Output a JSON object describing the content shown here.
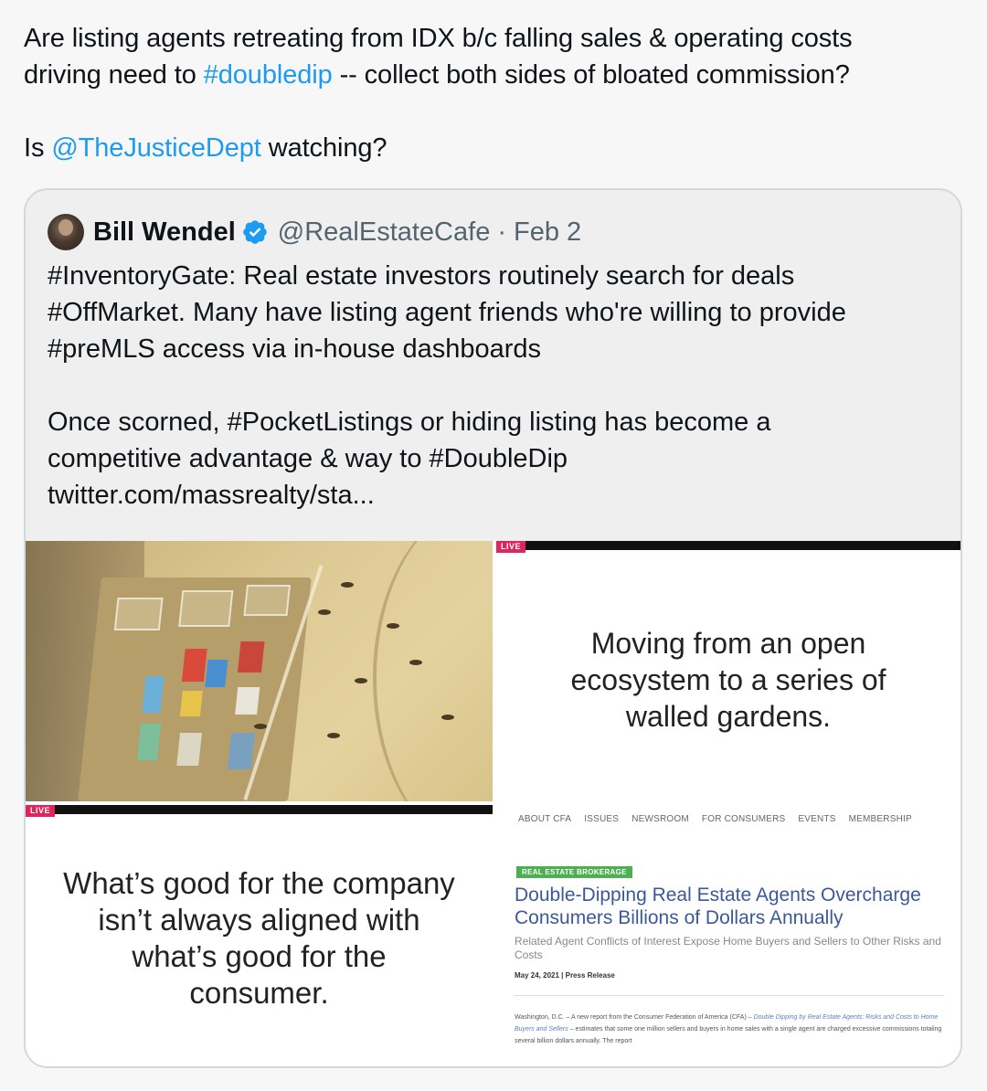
{
  "tweet": {
    "line1_a": "Are listing agents retreating from IDX b/c falling sales & operating costs",
    "line2_a": "driving need to ",
    "line2_link": "#doubledip",
    "line2_b": " -- collect both sides of bloated commission?",
    "line3_a": "Is ",
    "line3_link": "@TheJusticeDept",
    "line3_b": " watching?"
  },
  "quote": {
    "display_name": "Bill Wendel",
    "handle": "@RealEstateCafe",
    "separator": "·",
    "date": "Feb 2",
    "verified_icon": "verified-badge-icon",
    "body_lines_1": [
      "#InventoryGate: Real estate investors routinely search for deals",
      "#OffMarket.  Many have listing agent friends who're willing to provide",
      "#preMLS access via in-house dashboards"
    ],
    "body_lines_2": [
      "Once scorned, #PocketListings or hiding listing has become a",
      "competitive advantage & way to #DoubleDip",
      "twitter.com/massrealty/sta..."
    ]
  },
  "media": {
    "tile2": {
      "live": "LIVE",
      "text_lines": [
        "Moving from an open",
        "ecosystem to a series of",
        "walled gardens."
      ]
    },
    "tile3": {
      "live": "LIVE",
      "text_lines": [
        "What’s good for the company",
        "isn’t always aligned with",
        "what’s good for the",
        "consumer."
      ]
    },
    "tile4": {
      "nav": [
        "ABOUT CFA",
        "ISSUES",
        "NEWSROOM",
        "FOR CONSUMERS",
        "EVENTS",
        "MEMBERSHIP"
      ],
      "tag": "REAL ESTATE BROKERAGE",
      "title": "Double-Dipping Real Estate Agents Overcharge Consumers Billions of Dollars Annually",
      "subtitle": "Related Agent Conflicts of Interest Expose Home Buyers and Sellers to Other Risks and Costs",
      "date": "May 24, 2021  |  Press Release",
      "para_a": "Washington, D.C. – A new report from the Consumer Federation of America (CFA) – ",
      "para_link": "Double Dipping by Real Estate Agents: Risks and Costs to Home Buyers and Sellers",
      "para_b": " – estimates that some one million sellers and buyers in home sales with a single agent are charged excessive commissions totaling several billion dollars annually. The report"
    }
  },
  "colors": {
    "link": "#1d9bf0",
    "verified": "#1d9bf0",
    "muted": "#536471",
    "cfa_title": "#3b5998",
    "cfa_tag": "#4caf50",
    "live": "#e0245e"
  }
}
